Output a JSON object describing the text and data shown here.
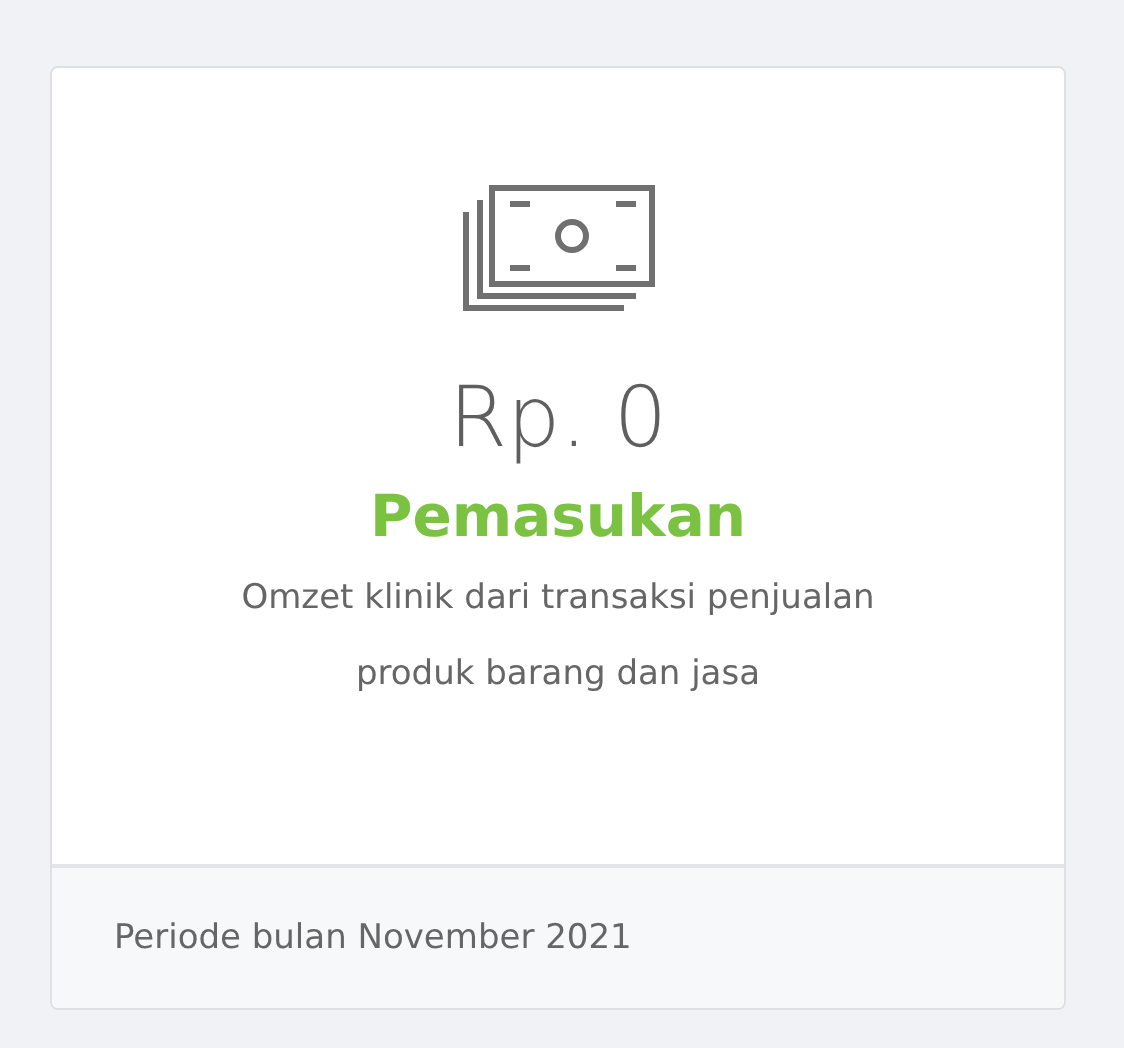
{
  "card": {
    "amount": "Rp. 0",
    "title": "Pemasukan",
    "description": "Omzet klinik dari transaksi penjualan produk barang dan jasa",
    "footer": "Periode bulan November 2021"
  }
}
